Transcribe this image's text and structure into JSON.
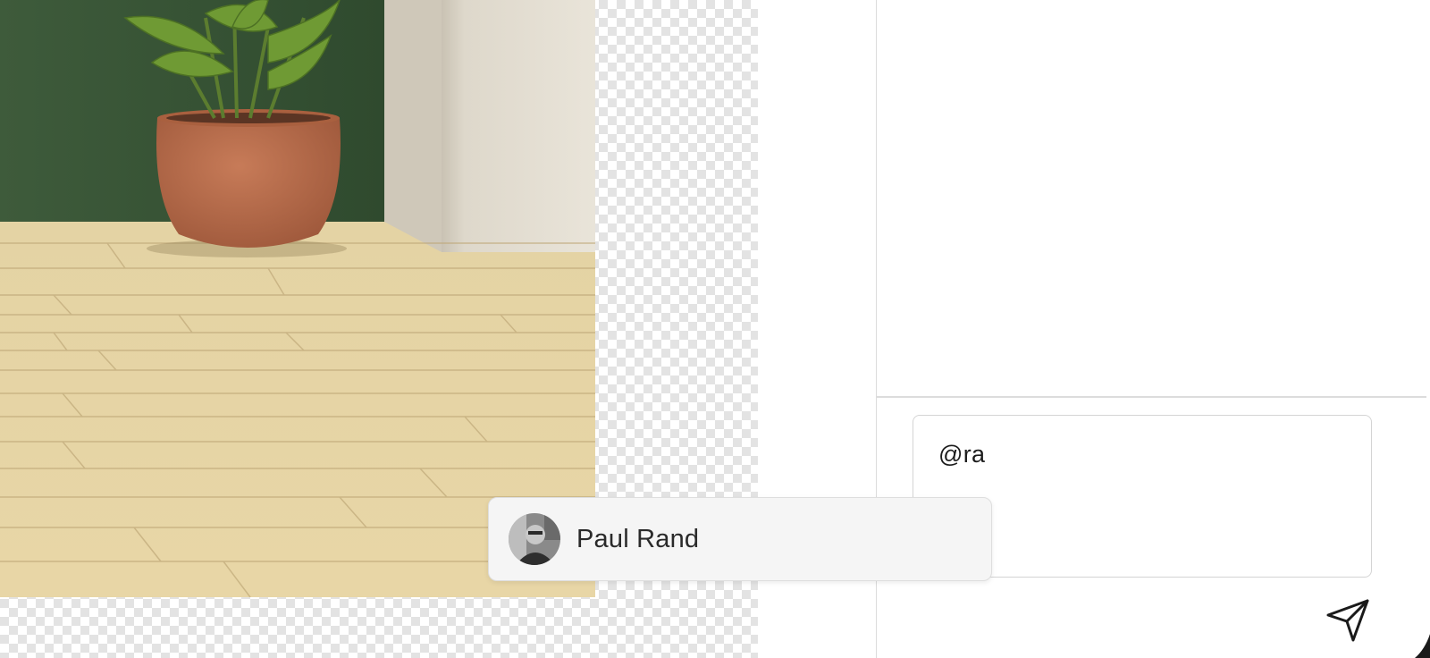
{
  "canvas": {
    "image_name": "room-render-plant",
    "background": "transparent-checkerboard"
  },
  "comment_composer": {
    "input_value": "@ra",
    "send_icon": "send-icon"
  },
  "mention_dropdown": {
    "options": [
      {
        "name": "Paul Rand",
        "avatar": "avatar-photo"
      }
    ]
  },
  "colors": {
    "panel_border": "#dcdcdc",
    "popup_bg": "#f5f5f5",
    "text": "#1c1c1c"
  }
}
